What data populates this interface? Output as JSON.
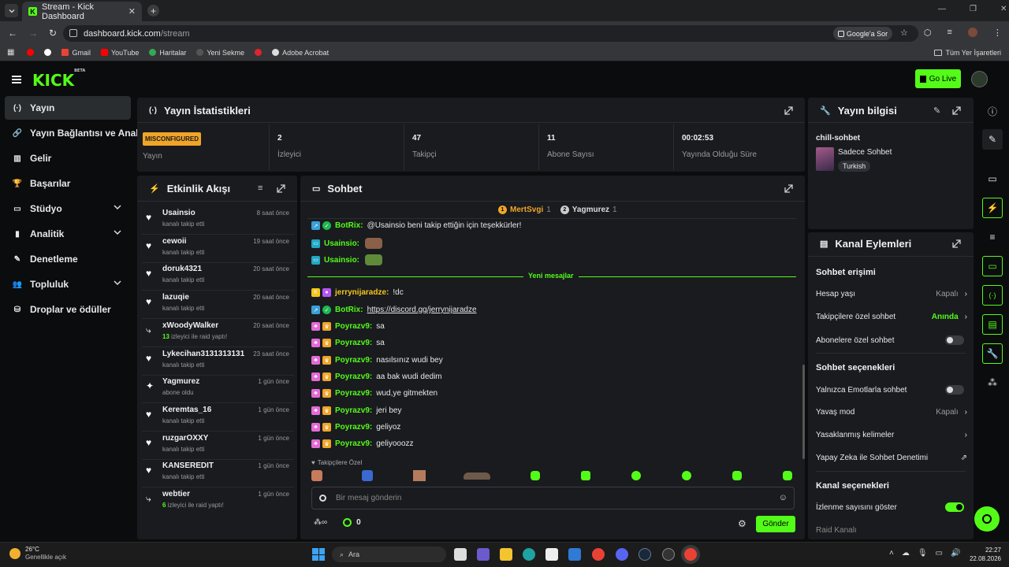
{
  "browser": {
    "tab_title": "Stream - Kick Dashboard",
    "url_host": "dashboard.kick.com",
    "url_path": "/stream",
    "google_btn": "Google'a Sor",
    "bookmarks": [
      "Gmail",
      "YouTube",
      "Haritalar",
      "Yeni Sekme",
      "Adobe Acrobat"
    ],
    "all_bookmarks": "Tüm Yer İşaretleri"
  },
  "topbar": {
    "logo": "KICK",
    "logo_beta": "BETA",
    "golive": "Go Live"
  },
  "sidebar": {
    "items": [
      {
        "label": "Yayın",
        "icon": "broadcast-icon"
      },
      {
        "label": "Yayın Bağlantısı ve Anahtar",
        "icon": "link-icon"
      },
      {
        "label": "Gelir",
        "icon": "revenue-icon"
      },
      {
        "label": "Başarılar",
        "icon": "trophy-icon"
      },
      {
        "label": "Stüdyo",
        "icon": "studio-icon"
      },
      {
        "label": "Analitik",
        "icon": "analytics-icon"
      },
      {
        "label": "Denetleme",
        "icon": "moderation-icon"
      },
      {
        "label": "Topluluk",
        "icon": "community-icon"
      },
      {
        "label": "Droplar ve ödüller",
        "icon": "drops-icon"
      }
    ]
  },
  "stats": {
    "title": "Yayın İstatistikleri",
    "status_badge": "MISCONFIGURED",
    "cells": [
      {
        "value": "",
        "label": "Yayın"
      },
      {
        "value": "2",
        "label": "İzleyici"
      },
      {
        "value": "47",
        "label": "Takipçi"
      },
      {
        "value": "11",
        "label": "Abone Sayısı"
      },
      {
        "value": "00:02:53",
        "label": "Yayında Olduğu Süre"
      }
    ]
  },
  "activity": {
    "title": "Etkinlik Akışı",
    "items": [
      {
        "name": "Usainsio",
        "sub": "kanalı takip etti",
        "time": "8 saat önce",
        "type": "follow"
      },
      {
        "name": "cewoii",
        "sub": "kanalı takip etti",
        "time": "19 saat önce",
        "type": "follow"
      },
      {
        "name": "doruk4321",
        "sub": "kanalı takip etti",
        "time": "20 saat önce",
        "type": "follow"
      },
      {
        "name": "lazuqie",
        "sub": "kanalı takip etti",
        "time": "20 saat önce",
        "type": "follow"
      },
      {
        "name": "xWoodyWalker",
        "count": "13",
        "sub": " izleyici ile raid yaptı!",
        "time": "20 saat önce",
        "type": "raid"
      },
      {
        "name": "Lykecihan3131313131",
        "sub": "kanalı takip etti",
        "time": "23 saat önce",
        "type": "follow"
      },
      {
        "name": "Yagmurez",
        "sub": "abone oldu",
        "time": "1 gün önce",
        "type": "sub"
      },
      {
        "name": "Keremtas_16",
        "sub": "kanalı takip etti",
        "time": "1 gün önce",
        "type": "follow"
      },
      {
        "name": "ruzgarOXXY",
        "sub": "kanalı takip etti",
        "time": "1 gün önce",
        "type": "follow"
      },
      {
        "name": "KANSEREDIT",
        "sub": "kanalı takip etti",
        "time": "1 gün önce",
        "type": "follow"
      },
      {
        "name": "webtier",
        "count": "6",
        "sub": " izleyici ile raid yaptı!",
        "time": "1 gün önce",
        "type": "raid"
      }
    ]
  },
  "chat": {
    "title": "Sohbet",
    "top_gifters": [
      {
        "rank": "1",
        "name": "MertSvgi",
        "count": "1"
      },
      {
        "rank": "2",
        "name": "Yagmurez",
        "count": "1"
      }
    ],
    "messages": [
      {
        "user": "BotRix:",
        "text": "@Usainsio beni takip ettiğin için teşekkürler!",
        "color": "#53fc18",
        "badges": [
          "bot",
          "verified"
        ]
      },
      {
        "user": "Usainsio:",
        "text": "",
        "color": "#53fc18",
        "badges": [
          "sub"
        ],
        "emote": true
      },
      {
        "user": "Usainsio:",
        "text": "",
        "color": "#53fc18",
        "badges": [
          "sub"
        ],
        "emote": true
      },
      {
        "user": "jerrynijaradze:",
        "text": "!dc",
        "color": "#f5c518",
        "badges": [
          "kick",
          "mic"
        ]
      },
      {
        "user": "BotRix:",
        "text": "https://discord.gg/jerrynijaradze",
        "color": "#53fc18",
        "badges": [
          "bot",
          "verified"
        ],
        "link": true
      },
      {
        "user": "Poyrazv9:",
        "text": "sa",
        "color": "#53fc18",
        "badges": [
          "gift",
          "crown"
        ]
      },
      {
        "user": "Poyrazv9:",
        "text": "sa",
        "color": "#53fc18",
        "badges": [
          "gift",
          "crown"
        ]
      },
      {
        "user": "Poyrazv9:",
        "text": "nasılsınız wudi bey",
        "color": "#53fc18",
        "badges": [
          "gift",
          "crown"
        ]
      },
      {
        "user": "Poyrazv9:",
        "text": "aa bak wudi dedim",
        "color": "#53fc18",
        "badges": [
          "gift",
          "crown"
        ]
      },
      {
        "user": "Poyrazv9:",
        "text": "wud,ye gitmekten",
        "color": "#53fc18",
        "badges": [
          "gift",
          "crown"
        ]
      },
      {
        "user": "Poyrazv9:",
        "text": "jeri bey",
        "color": "#53fc18",
        "badges": [
          "gift",
          "crown"
        ]
      },
      {
        "user": "Poyrazv9:",
        "text": "geliyoz",
        "color": "#53fc18",
        "badges": [
          "gift",
          "crown"
        ]
      },
      {
        "user": "Poyrazv9:",
        "text": "geliyooozz",
        "color": "#53fc18",
        "badges": [
          "gift",
          "crown"
        ]
      }
    ],
    "new_messages": "Yeni mesajlar",
    "followers_only": "Takipçilere Özel",
    "input_placeholder": "Bir mesaj gönderin",
    "points": "0",
    "send": "Gönder"
  },
  "stream_info": {
    "title": "Yayın bilgisi",
    "stream_title": "chill-sohbet",
    "category": "Sadece Sohbet",
    "language": "Turkish"
  },
  "channel_actions": {
    "title": "Kanal Eylemleri",
    "sections": [
      {
        "heading": "Sohbet erişimi"
      },
      {
        "heading": "Sohbet seçenekleri"
      },
      {
        "heading": "Kanal seçenekleri"
      }
    ],
    "rows": {
      "account_age": {
        "label": "Hesap yaşı",
        "value": "Kapalı"
      },
      "followers_only": {
        "label": "Takipçilere özel sohbet",
        "value": "Anında"
      },
      "subs_only": {
        "label": "Abonelere özel sohbet"
      },
      "emotes_only": {
        "label": "Yalnızca Emotlarla sohbet"
      },
      "slow_mode": {
        "label": "Yavaş mod",
        "value": "Kapalı"
      },
      "banned_words": {
        "label": "Yasaklanmış kelimeler"
      },
      "ai_moderation": {
        "label": "Yapay Zeka ile Sohbet Denetimi"
      },
      "show_viewers": {
        "label": "İzlenme sayısını göster"
      },
      "raid_channel": {
        "label": "Raid Kanalı"
      }
    }
  },
  "taskbar": {
    "weather_temp": "26°C",
    "weather_desc": "Genellikle açık",
    "search": "Ara",
    "time": "22:27",
    "date": "22.08.2026"
  }
}
